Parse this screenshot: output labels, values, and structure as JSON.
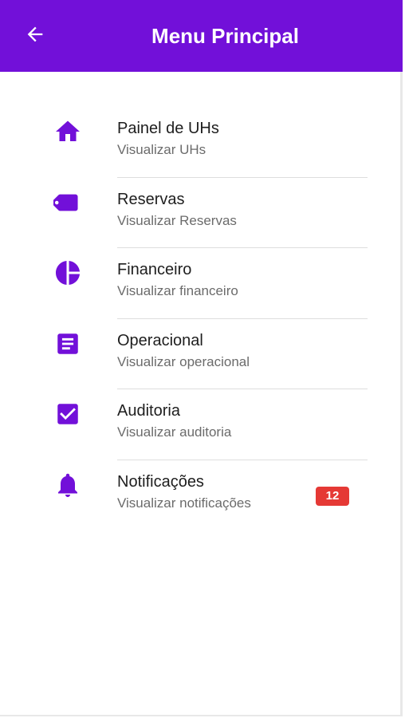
{
  "appbar": {
    "title": "Menu Principal",
    "back_icon": "arrow-back-icon",
    "background": "#7210d9"
  },
  "menu": {
    "accent_color": "#7210d9",
    "items": [
      {
        "title": "Painel de UHs",
        "subtitle": "Visualizar UHs",
        "icon": "home-icon"
      },
      {
        "title": "Reservas",
        "subtitle": "Visualizar Reservas",
        "icon": "tag-icon"
      },
      {
        "title": "Financeiro",
        "subtitle": "Visualizar financeiro",
        "icon": "pie-chart-icon"
      },
      {
        "title": "Operacional",
        "subtitle": "Visualizar operacional",
        "icon": "document-icon"
      },
      {
        "title": "Auditoria",
        "subtitle": "Visualizar auditoria",
        "icon": "checkbox-icon"
      },
      {
        "title": "Notificações",
        "subtitle": "Visualizar notificações",
        "icon": "bell-icon",
        "badge": "12"
      }
    ]
  },
  "badge_color": "#e53935"
}
